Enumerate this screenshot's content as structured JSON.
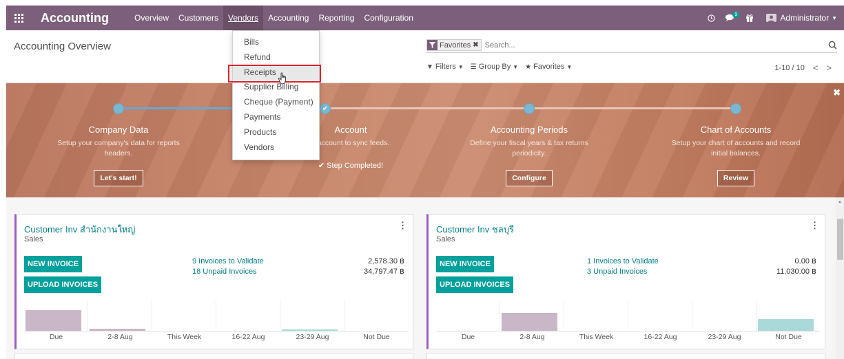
{
  "app": {
    "title": "Accounting"
  },
  "nav": {
    "menu": [
      {
        "label": "Overview"
      },
      {
        "label": "Customers"
      },
      {
        "label": "Vendors",
        "open": true
      },
      {
        "label": "Accounting"
      },
      {
        "label": "Reporting"
      },
      {
        "label": "Configuration"
      }
    ],
    "chat_badge": "9",
    "user": "Administrator"
  },
  "vendors_menu": {
    "items": [
      "Bills",
      "Refund",
      "Receipts",
      "Supplier Billing",
      "Cheque (Payment)",
      "Payments",
      "Products",
      "Vendors"
    ],
    "highlighted": "Receipts"
  },
  "control_panel": {
    "breadcrumb": "Accounting Overview",
    "facet": "Favorites",
    "search_placeholder": "Search...",
    "filters_label": "Filters",
    "groupby_label": "Group By",
    "favorites_label": "Favorites",
    "pager": "1-10 / 10"
  },
  "onboarding": {
    "steps": [
      {
        "title": "Company Data",
        "desc": "Setup your company's data for reports headers.",
        "button": "Let's start!"
      },
      {
        "title": "Account",
        "desc": "k account to sync feeds.",
        "done_label": "Step Completed!"
      },
      {
        "title": "Accounting Periods",
        "desc": "Define your fiscal years & tax returns periodicity.",
        "button": "Configure"
      },
      {
        "title": "Chart of Accounts",
        "desc": "Setup your chart of accounts and record initial balances.",
        "button": "Review"
      }
    ]
  },
  "journals": [
    {
      "title": "Customer Inv สำนักงานใหญ่",
      "type": "Sales",
      "new_invoice": "NEW INVOICE",
      "upload_invoices": "UPLOAD INVOICES",
      "to_validate": "9 Invoices to Validate",
      "unpaid": "18 Unpaid Invoices",
      "to_validate_amount": "2,578.30 ฿",
      "unpaid_amount": "34,797.47 ฿",
      "graph": {
        "labels": [
          "Due",
          "2-8 Aug",
          "This Week",
          "16-22 Aug",
          "23-29 Aug",
          "Not Due"
        ],
        "values": [
          30,
          3,
          0,
          0,
          2,
          0
        ]
      }
    },
    {
      "title": "Customer Inv ชลบุรี",
      "type": "Sales",
      "new_invoice": "NEW INVOICE",
      "upload_invoices": "UPLOAD INVOICES",
      "to_validate": "1 Invoices to Validate",
      "unpaid": "3 Unpaid Invoices",
      "to_validate_amount": "0.00 ฿",
      "unpaid_amount": "11,030.00 ฿",
      "graph": {
        "labels": [
          "Due",
          "2-8 Aug",
          "This Week",
          "16-22 Aug",
          "23-29 Aug",
          "Not Due"
        ],
        "values": [
          0,
          26,
          0,
          0,
          0,
          17
        ]
      }
    }
  ],
  "colors": {
    "navbar": "#7c5f7a",
    "primary": "#00a09d",
    "link": "#017e84",
    "highlight": "#d9232d"
  }
}
